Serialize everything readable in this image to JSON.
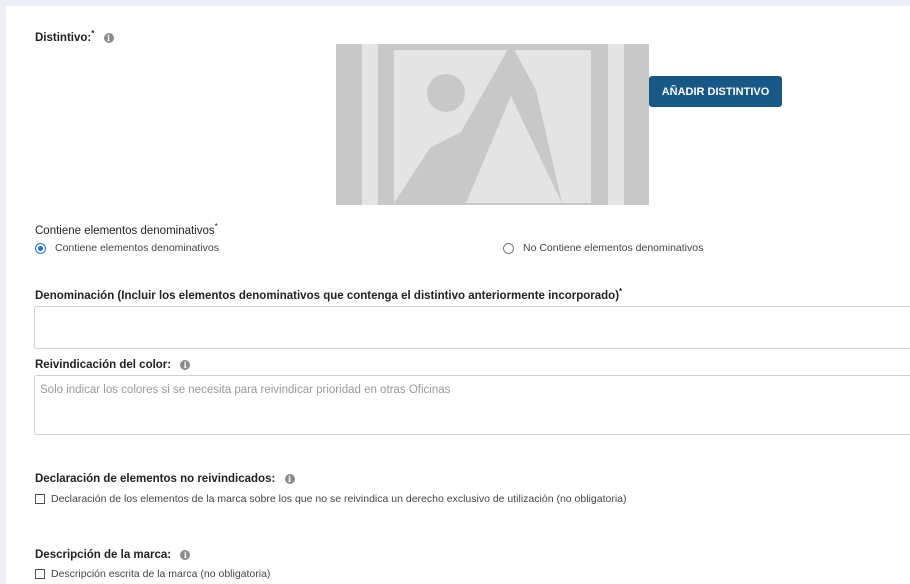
{
  "distintivo": {
    "label": "Distintivo:",
    "required_mark": "*",
    "info_glyph": "i",
    "add_button": "AÑADIR DISTINTIVO"
  },
  "denominativos": {
    "label": "Contiene elementos denominativos",
    "required_mark": "*",
    "option_yes": "Contiene elementos denominativos",
    "option_no": "No Contiene elementos denominativos",
    "selected": "yes"
  },
  "denominacion": {
    "label": "Denominación (Incluir los elementos denominativos que contenga el distintivo anteriormente incorporado)",
    "required_mark": "*",
    "value": ""
  },
  "color": {
    "label": "Reivindicación del color:",
    "info_glyph": "i",
    "placeholder": "Solo indicar los colores si se necesita para reivindicar prioridad en otras Oficinas"
  },
  "no_reivindicados": {
    "label": "Declaración de elementos no reivindicados:",
    "info_glyph": "i",
    "checkbox_label": "Declaración de los elementos de la marca sobre los que no se reivindica un derecho exclusivo de utilización (no obligatoria)",
    "checked": false
  },
  "descripcion": {
    "label": "Descripción de la marca:",
    "info_glyph": "i",
    "checkbox_label": "Descripción escrita de la marca (no obligatoria)",
    "checked": false
  },
  "colors": {
    "page_bg": "#eef0f8",
    "button_bg": "#175887",
    "radio_accent": "#1a73e8",
    "placeholder_image": "#c8c8c8"
  }
}
